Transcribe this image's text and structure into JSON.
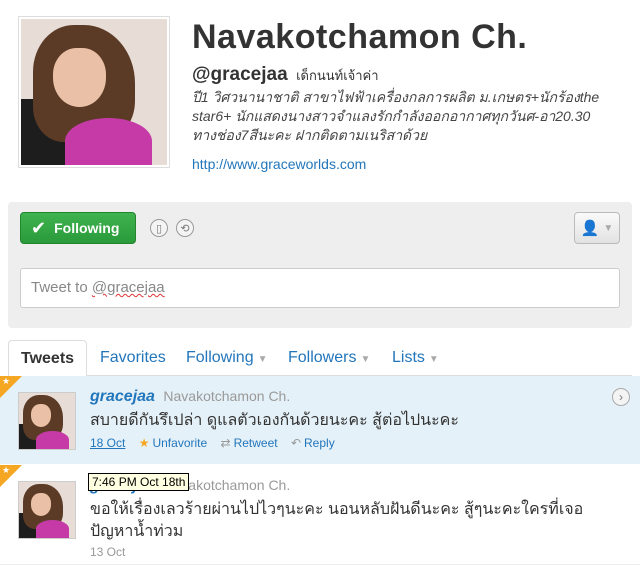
{
  "profile": {
    "full_name": "Navakotchamon Ch.",
    "screen_name": "@gracejaa",
    "location": "เด็กนนท์เจ้าค่า",
    "bio": "ปี1 วิศวนานาชาติ สาขาไฟฟ้าเครื่องกลการผลิต ม.เกษตร+นักร้องthe star6+ นักแสดงนางสาวจำแลงรักกำลังออกอากาศทุกวันศ-อา20.30 ทางช่อง7สีนะคะ ฝากติดตามเนริสาด้วย",
    "url": "http://www.graceworlds.com",
    "avatar_icon": "profile-photo"
  },
  "actions": {
    "follow_label": "Following",
    "follow_color": "#2fa83f",
    "tweet_placeholder_prefix": "Tweet to ",
    "tweet_placeholder_handle": "@gracejaa"
  },
  "tabs": [
    {
      "label": "Tweets"
    },
    {
      "label": "Favorites"
    },
    {
      "label": "Following"
    },
    {
      "label": "Followers"
    },
    {
      "label": "Lists"
    }
  ],
  "tweets": [
    {
      "user": "gracejaa",
      "name": "Navakotchamon Ch.",
      "text": "สบายดีกันรึเปล่า ดูแลตัวเองกันด้วยนะคะ สู้ต่อไปนะคะ",
      "timestamp": "18 Oct",
      "favorite_label": "Unfavorite",
      "retweet_label": "Retweet",
      "reply_label": "Reply"
    },
    {
      "user": "gracejaa",
      "name": "Navakotchamon Ch.",
      "text": "ขอให้เรื่องเลวร้ายผ่านไปไวๆนะคะ นอนหลับฝันดีนะคะ สู้ๆนะคะใครที่เจอปัญหาน้ำท่วม",
      "timestamp": "13 Oct"
    }
  ],
  "tooltip": "7:46 PM Oct 18th",
  "colors": {
    "link": "#2276bb",
    "highlight_row": "#e5f1f8",
    "favorite_flag": "#f5a623"
  }
}
